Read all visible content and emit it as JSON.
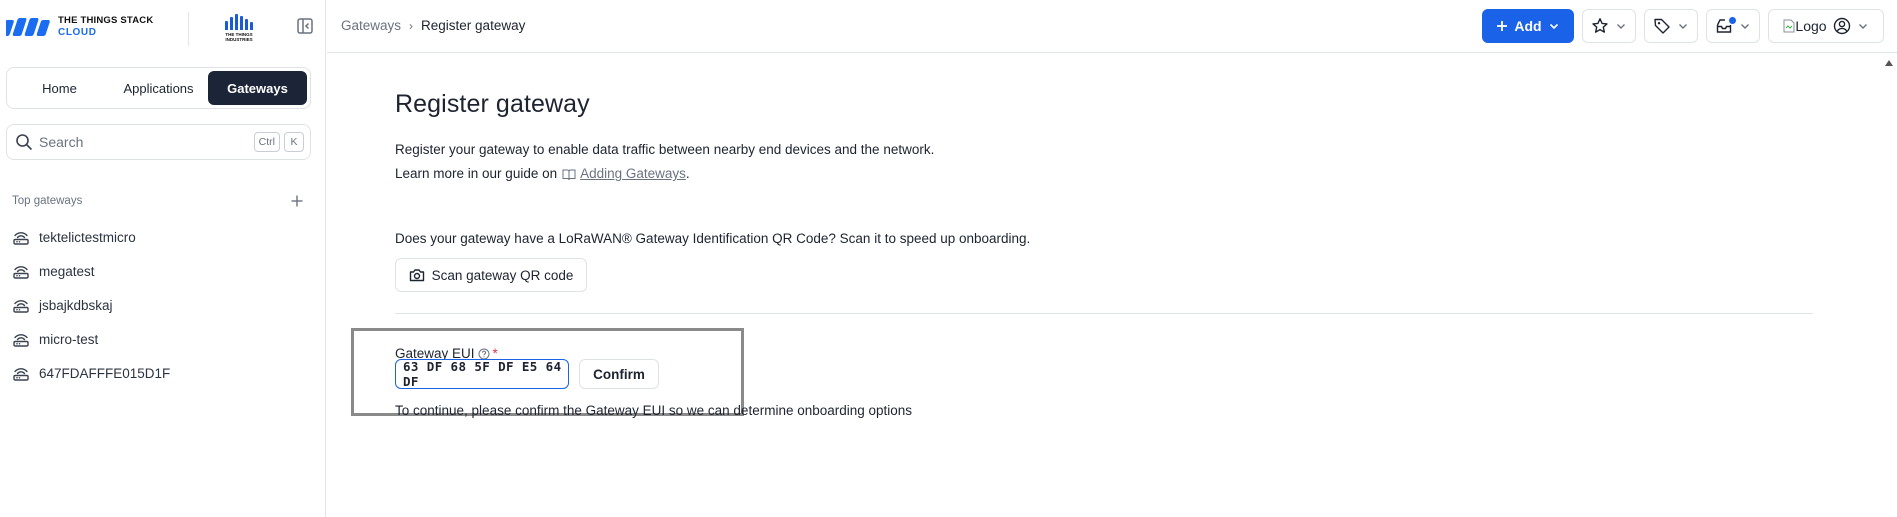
{
  "brand": {
    "line1": "THE THINGS STACK",
    "line2": "CLOUD",
    "partner_line1": "THE THINGS",
    "partner_line2": "INDUSTRIES"
  },
  "nav": {
    "tabs": [
      {
        "label": "Home",
        "active": false
      },
      {
        "label": "Applications",
        "active": false
      },
      {
        "label": "Gateways",
        "active": true
      }
    ]
  },
  "search": {
    "placeholder": "Search",
    "shortcut_1": "Ctrl",
    "shortcut_2": "K"
  },
  "top_gateways": {
    "label": "Top gateways",
    "items": [
      "tektelictestmicro",
      "megatest",
      "jsbajkdbskaj",
      "micro-test",
      "647FDAFFFE015D1F"
    ]
  },
  "header": {
    "breadcrumb_parent": "Gateways",
    "breadcrumb_current": "Register gateway",
    "add_label": "Add",
    "profile_logo_alt": "Logo"
  },
  "page": {
    "title": "Register gateway",
    "description": "Register your gateway to enable data traffic between nearby end devices and the network.",
    "guide_prefix": "Learn more in our guide on",
    "guide_link": "Adding Gateways",
    "guide_suffix": ".",
    "qr_question": "Does your gateway have a LoRaWAN® Gateway Identification QR Code? Scan it to speed up onboarding.",
    "scan_label": "Scan gateway QR code",
    "eui_label": "Gateway EUI",
    "eui_required": "*",
    "eui_value": "63 DF 68 5F DF E5 64 DF",
    "confirm_label": "Confirm",
    "continue_text": "To continue, please confirm the Gateway EUI so we can determine onboarding options"
  },
  "colors": {
    "primary": "#1a62e8",
    "nav_active": "#1c2537",
    "required": "#e0334d",
    "highlight_box": "#8a8a8a"
  }
}
